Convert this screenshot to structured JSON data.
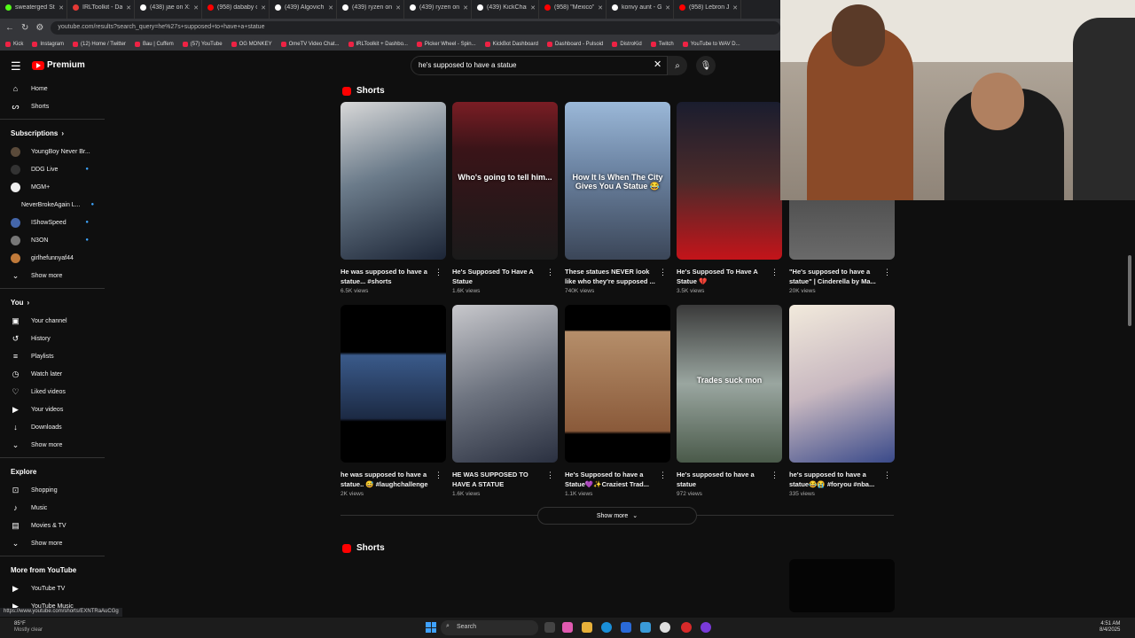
{
  "browser": {
    "tabs": [
      {
        "label": "sweaterged Stre",
        "color": "#53fc18"
      },
      {
        "label": "IRLToolkit - Das",
        "color": "#e53935"
      },
      {
        "label": "(438) jae on X:",
        "color": "#ffffff"
      },
      {
        "label": "(958) dababy o",
        "color": "#ff0000"
      },
      {
        "label": "(439) Algovich",
        "color": "#ffffff"
      },
      {
        "label": "(439) ryzen on",
        "color": "#ffffff"
      },
      {
        "label": "(439) ryzen on",
        "color": "#ffffff"
      },
      {
        "label": "(439) KickCham",
        "color": "#ffffff"
      },
      {
        "label": "(958) \"Mexico\"",
        "color": "#ff0000"
      },
      {
        "label": "konvy aunt - G",
        "color": "#ffffff"
      },
      {
        "label": "(958) Lebron Ja",
        "color": "#ff0000"
      }
    ],
    "url": "youtube.com/results?search_query=he%27s+supposed+to+have+a+statue",
    "bookmarks": [
      "Kick",
      "Instagram",
      "(12) Home / Twitter",
      "Bau | Cuffem",
      "(57) YouTube",
      "OG MONKEY",
      "OmeTV Video Chat...",
      "IRLToolkit + Dashbo...",
      "Picker Wheel - Spin...",
      "KickBot Dashboard",
      "Dashboard - Pulsoid",
      "DistroKid",
      "Twitch",
      "YouTube to WAV D..."
    ]
  },
  "header": {
    "logo": "Premium",
    "search_value": "he's supposed to have a statue"
  },
  "sidebar": {
    "top": [
      {
        "icon": "⌂",
        "icon_name": "home-icon",
        "label": "Home"
      },
      {
        "icon": "ᔕ",
        "icon_name": "shorts-icon",
        "label": "Shorts"
      }
    ],
    "subscriptions_title": "Subscriptions",
    "subscriptions": [
      {
        "label": "YoungBoy Never Br...",
        "color": "#5a4a3a",
        "dot": false
      },
      {
        "label": "DDG Live",
        "color": "#333",
        "dot": true
      },
      {
        "label": "MGM+",
        "color": "#eee",
        "dot": false
      },
      {
        "label": "NeverBrokeAgain L...",
        "color": "#2e8b3a",
        "dot": true
      },
      {
        "label": "IShowSpeed",
        "color": "#4466aa",
        "dot": true
      },
      {
        "label": "N3ON",
        "color": "#777",
        "dot": true
      },
      {
        "label": "girlhefunnyaf44",
        "color": "#c07a3a",
        "dot": false
      }
    ],
    "show_more_1": "Show more",
    "you_title": "You",
    "you": [
      {
        "icon": "▣",
        "icon_name": "your-channel-icon",
        "label": "Your channel"
      },
      {
        "icon": "↺",
        "icon_name": "history-icon",
        "label": "History"
      },
      {
        "icon": "≡",
        "icon_name": "playlists-icon",
        "label": "Playlists"
      },
      {
        "icon": "◷",
        "icon_name": "watch-later-icon",
        "label": "Watch later"
      },
      {
        "icon": "♡",
        "icon_name": "liked-videos-icon",
        "label": "Liked videos"
      },
      {
        "icon": "▶",
        "icon_name": "your-videos-icon",
        "label": "Your videos"
      },
      {
        "icon": "↓",
        "icon_name": "downloads-icon",
        "label": "Downloads"
      }
    ],
    "show_more_2": "Show more",
    "explore_title": "Explore",
    "explore": [
      {
        "icon": "⊡",
        "icon_name": "shopping-icon",
        "label": "Shopping"
      },
      {
        "icon": "♪",
        "icon_name": "music-icon",
        "label": "Music"
      },
      {
        "icon": "▤",
        "icon_name": "movies-icon",
        "label": "Movies & TV"
      }
    ],
    "show_more_3": "Show more",
    "more_title": "More from YouTube",
    "more": [
      {
        "icon": "▶",
        "icon_name": "youtube-tv-icon",
        "label": "YouTube TV"
      },
      {
        "icon": "▶",
        "icon_name": "youtube-music-icon",
        "label": "YouTube Music"
      }
    ]
  },
  "shorts_section": {
    "title": "Shorts",
    "row1": [
      {
        "title": "He was supposed to have a statue... #shorts",
        "views": "6.5K views",
        "bg": "linear-gradient(160deg,#d8d8d8,#6b7b8a 45%,#1c2536)",
        "overlay": ""
      },
      {
        "title": "He's Supposed To Have A Statue",
        "views": "1.6K views",
        "bg": "linear-gradient(180deg,#7a1d24,#3a1418 30%,#1a1a1a)",
        "overlay": "Who's going to tell him..."
      },
      {
        "title": "These statues NEVER look like who they're supposed ...",
        "views": "740K views",
        "bg": "linear-gradient(180deg,#9bb8d8,#6f87a6 40%,#3b4658)",
        "overlay": "How It Is When The City Gives You A Statue 😂"
      },
      {
        "title": "He's Supposed To Have A Statue 💔",
        "views": "3.5K views",
        "bg": "linear-gradient(180deg,#1a1d2e,#4b2a2a 50%,#c4141a)",
        "overlay": ""
      },
      {
        "title": "\"He's supposed to have a statue\" | Cinderella by Ma...",
        "views": "20K views",
        "bg": "linear-gradient(180deg,#2a2a2a,#6a6a6a)",
        "overlay": ""
      }
    ],
    "row2": [
      {
        "title": "he was supposed to have a statue.. 😅 #laughchallenge",
        "views": "2K views",
        "bg": "linear-gradient(180deg,#000 30%,#3a5a8a 32%,#1c2a44 72%,#000 74%)",
        "overlay": ""
      },
      {
        "title": "HE WAS SUPPOSED TO HAVE A STATUE",
        "views": "1.6K views",
        "bg": "linear-gradient(160deg,#c8c8cc,#6e7480 50%,#2a3040)",
        "overlay": ""
      },
      {
        "title": "He's Supposed to have a Statue💜✨Craziest Trad...",
        "views": "1.1K views",
        "bg": "linear-gradient(180deg,#000 16%,#b58e6a 17%,#8a5a3a 80%,#000 82%)",
        "overlay": ""
      },
      {
        "title": "He's supposed to have a statue",
        "views": "972 views",
        "bg": "linear-gradient(180deg,#3a3a3a,#9aa6a0 50%,#4a5a4a)",
        "overlay": "Trades suck mon"
      },
      {
        "title": "he's supposed to have a statue😂😭 #foryou #nba...",
        "views": "335 views",
        "bg": "linear-gradient(160deg,#f2eadc,#c8b8c0 50%,#3a4a8a)",
        "overlay": ""
      }
    ],
    "show_more": "Show more"
  },
  "shorts_section_2": {
    "title": "Shorts"
  },
  "status_url": "https://www.youtube.com/shorts/EXNTRaAuCGg",
  "taskbar": {
    "temp": "85°F",
    "weather": "Mostly clear",
    "search": "Search",
    "time": "4:51 AM",
    "date": "8/4/2025"
  }
}
